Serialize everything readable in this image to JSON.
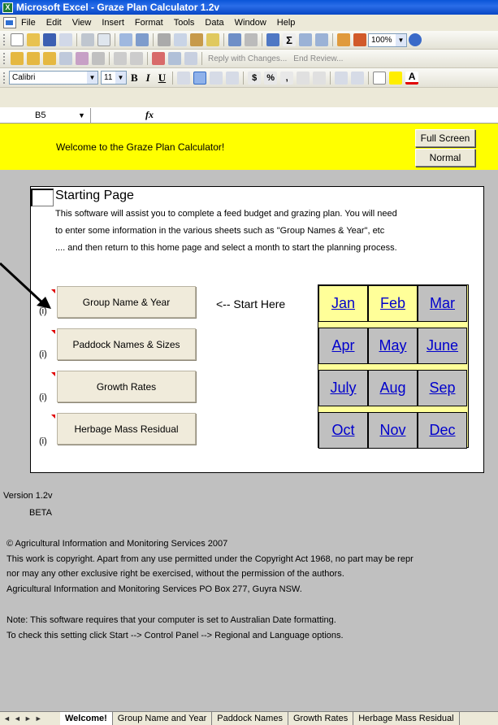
{
  "window": {
    "title": "Microsoft Excel - Graze Plan Calculator 1.2v",
    "app_icon": "excel-icon"
  },
  "menu": [
    "File",
    "Edit",
    "View",
    "Insert",
    "Format",
    "Tools",
    "Data",
    "Window",
    "Help"
  ],
  "toolbar": {
    "zoom": "100%",
    "reply_label": "Reply with Changes...",
    "end_review_label": "End Review...",
    "font_name": "Calibri",
    "font_size": "11",
    "bold": "B",
    "italic": "I",
    "underline": "U"
  },
  "formula_bar": {
    "cell": "B5",
    "fx": "fx"
  },
  "banner": {
    "welcome": "Welcome to the Graze Plan Calculator!",
    "full_screen_label": "Full Screen",
    "normal_label": "Normal",
    "color": "#ffff00"
  },
  "start": {
    "title": "Starting Page",
    "lines": [
      "This software will assist you to complete a feed budget and grazing plan.  You will need",
      "to enter some information in the various sheets such as \"Group Names & Year\", etc",
      ".... and then return to this home page and select a month to start the planning process."
    ],
    "start_here": "<-- Start Here",
    "buttons": [
      {
        "label": "Group Name & Year",
        "info": "(i)"
      },
      {
        "label": "Paddock Names & Sizes",
        "info": "(i)"
      },
      {
        "label": "Growth Rates",
        "info": "(i)"
      },
      {
        "label": "Herbage Mass Residual",
        "info": "(i)"
      }
    ],
    "months": [
      "Jan",
      "Feb",
      "Mar",
      "Apr",
      "May",
      "June",
      "July",
      "Aug",
      "Sep",
      "Oct",
      "Nov",
      "Dec"
    ],
    "highlighted_months": [
      "Jan",
      "Feb"
    ]
  },
  "footer": {
    "version": "Version 1.2v",
    "beta": "BETA",
    "copyright_lines": [
      "© Agricultural Information and Monitoring Services  2007",
      "This work is copyright.  Apart from any use permitted under the Copyright Act 1968, no part may be repr",
      "nor may any other exclusive right be exercised, without the permission of the authors.",
      "Agricultural Information and Monitoring Services PO Box 277, Guyra NSW."
    ],
    "note_lines": [
      "Note: This software requires that your computer is set to Australian Date formatting.",
      "To check this setting click Start --> Control Panel --> Regional and Language options."
    ]
  },
  "sheet_tabs": [
    "Welcome!",
    "Group Name and Year",
    "Paddock Names",
    "Growth Rates",
    "Herbage Mass Residual"
  ],
  "active_tab": "Welcome!"
}
